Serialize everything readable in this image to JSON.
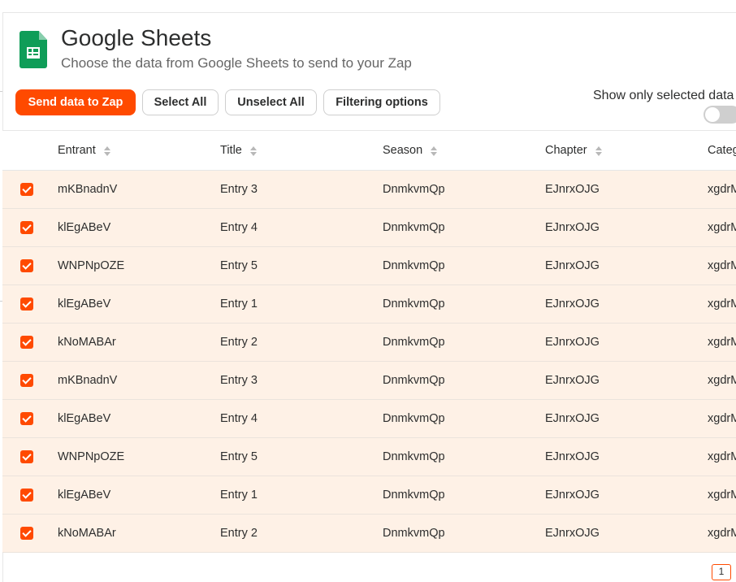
{
  "header": {
    "title": "Google Sheets",
    "subtitle": "Choose the data from Google Sheets to send to your Zap",
    "app_icon": "google-sheets-icon"
  },
  "toolbar": {
    "send_label": "Send data to Zap",
    "select_all_label": "Select All",
    "unselect_all_label": "Unselect All",
    "filtering_label": "Filtering options",
    "show_selected_label": "Show only selected data",
    "show_selected_enabled": false
  },
  "colors": {
    "accent": "#ff4a00",
    "row_selected_bg": "#fef1e6",
    "sheets_green": "#0f9d58"
  },
  "table": {
    "columns": [
      "Entrant",
      "Title",
      "Season",
      "Chapter",
      "Category"
    ],
    "rows": [
      {
        "selected": true,
        "entrant": "mKBnadnV",
        "title": "Entry 3",
        "season": "DnmkvmQp",
        "chapter": "EJnrxOJG",
        "category": "xgdrMxzL"
      },
      {
        "selected": true,
        "entrant": "klEgABeV",
        "title": "Entry 4",
        "season": "DnmkvmQp",
        "chapter": "EJnrxOJG",
        "category": "xgdrMxzL"
      },
      {
        "selected": true,
        "entrant": "WNPNpOZE",
        "title": "Entry 5",
        "season": "DnmkvmQp",
        "chapter": "EJnrxOJG",
        "category": "xgdrMxzL"
      },
      {
        "selected": true,
        "entrant": "klEgABeV",
        "title": "Entry 1",
        "season": "DnmkvmQp",
        "chapter": "EJnrxOJG",
        "category": "xgdrMxzL"
      },
      {
        "selected": true,
        "entrant": "kNoMABAr",
        "title": "Entry 2",
        "season": "DnmkvmQp",
        "chapter": "EJnrxOJG",
        "category": "xgdrMxzL"
      },
      {
        "selected": true,
        "entrant": "mKBnadnV",
        "title": "Entry 3",
        "season": "DnmkvmQp",
        "chapter": "EJnrxOJG",
        "category": "xgdrMxzL"
      },
      {
        "selected": true,
        "entrant": "klEgABeV",
        "title": "Entry 4",
        "season": "DnmkvmQp",
        "chapter": "EJnrxOJG",
        "category": "xgdrMxzL"
      },
      {
        "selected": true,
        "entrant": "WNPNpOZE",
        "title": "Entry 5",
        "season": "DnmkvmQp",
        "chapter": "EJnrxOJG",
        "category": "xgdrMxzL"
      },
      {
        "selected": true,
        "entrant": "klEgABeV",
        "title": "Entry 1",
        "season": "DnmkvmQp",
        "chapter": "EJnrxOJG",
        "category": "xgdrMxzL"
      },
      {
        "selected": true,
        "entrant": "kNoMABAr",
        "title": "Entry 2",
        "season": "DnmkvmQp",
        "chapter": "EJnrxOJG",
        "category": "xgdrMxzL"
      }
    ]
  },
  "pagination": {
    "current_page": "1"
  }
}
